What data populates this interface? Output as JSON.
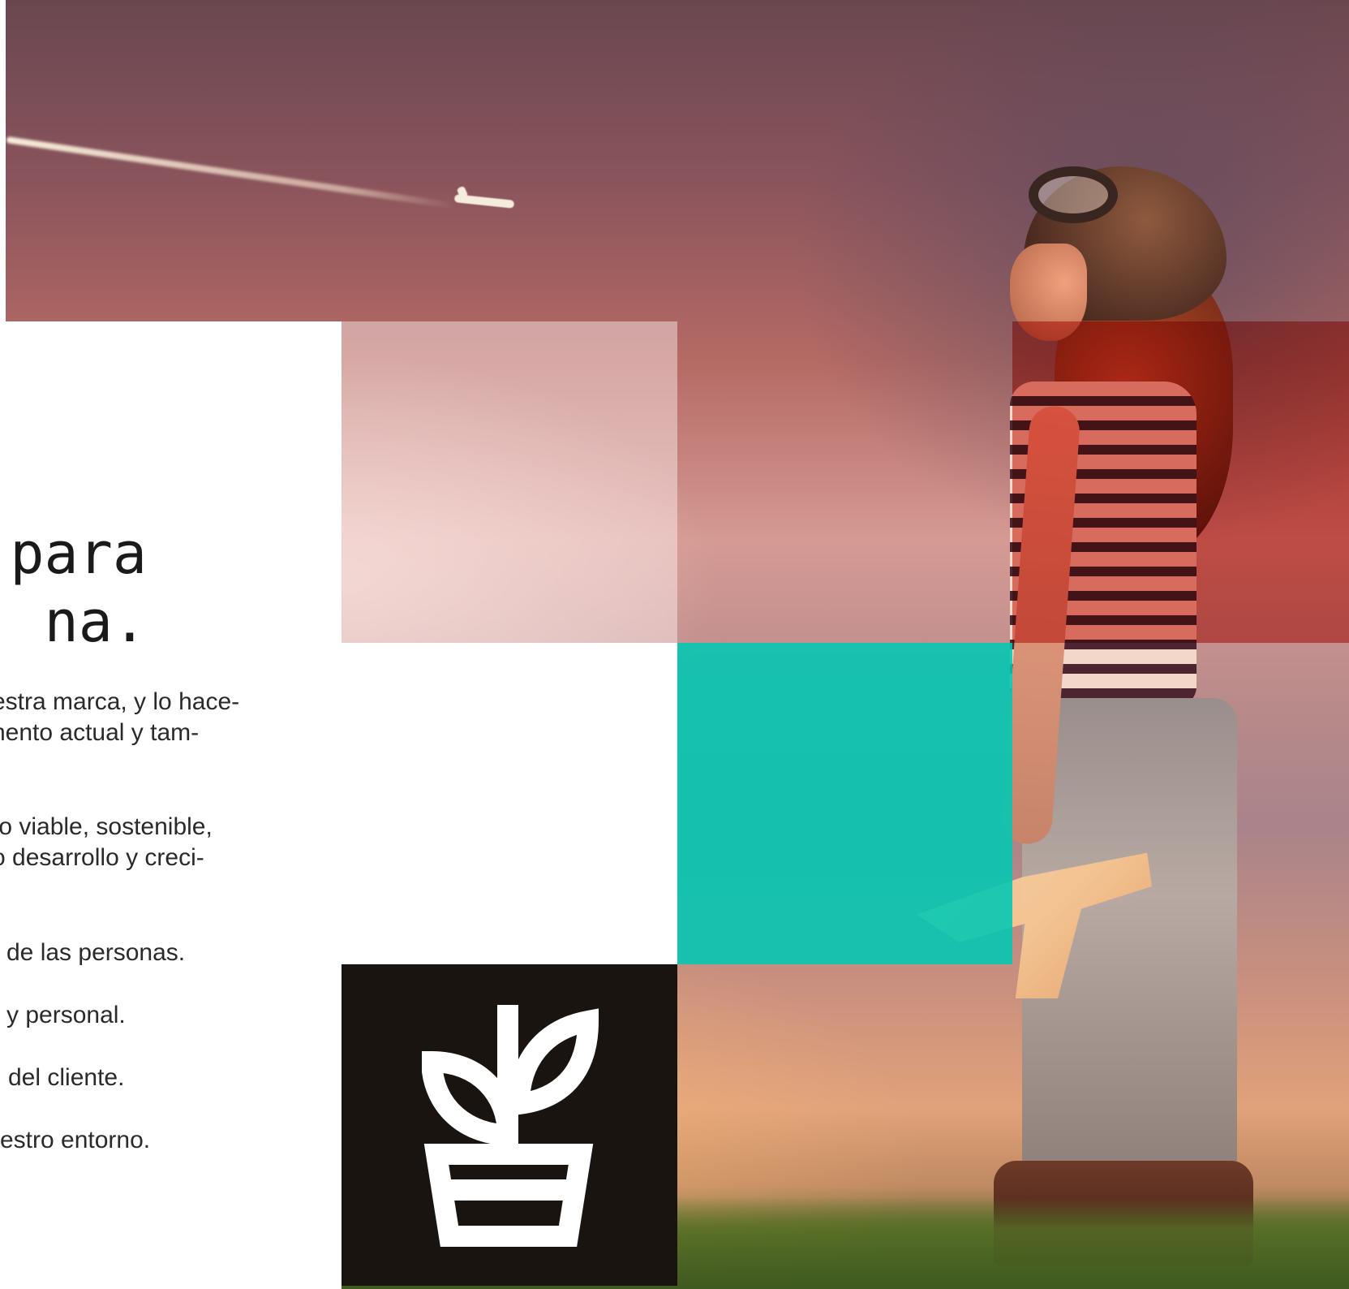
{
  "headline": {
    "line1": "a para",
    "line2": "na."
  },
  "paragraphs": [
    {
      "line1": "estra marca, y lo hace-",
      "line2": "nento actual y tam-"
    },
    {
      "line1": "to viable, sostenible,",
      "line2": "o desarrollo y creci-"
    }
  ],
  "list_items": [
    "de las personas.",
    "y personal.",
    "del cliente.",
    "estro entorno."
  ],
  "colors": {
    "accent_red": "#c8140a",
    "accent_teal": "#00c8b4",
    "dark_tile": "#191410",
    "text": "#2a2a2a"
  },
  "icons": {
    "tile_icon": "plant-pot-icon"
  }
}
